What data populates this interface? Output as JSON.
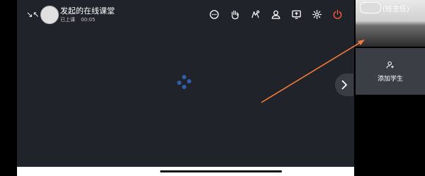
{
  "header": {
    "class_title": "发起的在线课堂",
    "status_label": "已上课",
    "elapsed": "00:05"
  },
  "toolbar": {
    "buttons": [
      {
        "name": "chat-icon"
      },
      {
        "name": "hand-raise-icon"
      },
      {
        "name": "interaction-icon"
      },
      {
        "name": "member-icon"
      },
      {
        "name": "screen-share-icon"
      },
      {
        "name": "settings-icon"
      },
      {
        "name": "power-icon",
        "color": "#ff5a3c"
      }
    ]
  },
  "right_panel": {
    "teacher_label": "(班主任)",
    "add_student_label": "添加学生"
  },
  "colors": {
    "stage_bg": "#20232a",
    "spinner": "#2f5fa8",
    "annotation_arrow": "#f07a3c",
    "exit_button": "#ff5a3c"
  }
}
